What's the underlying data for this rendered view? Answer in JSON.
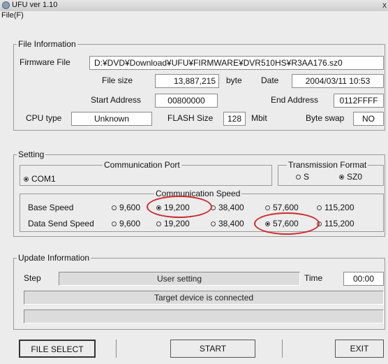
{
  "window": {
    "title": "UFU  ver 1.10",
    "close": "x"
  },
  "menu": {
    "file": "File(F)"
  },
  "file_info": {
    "legend": "File Information",
    "firmware_label": "Firmware File",
    "firmware_path": "D:¥DVD¥Download¥UFU¥FIRMWARE¥DVR510HS¥R3AA176.sz0",
    "filesize_label": "File size",
    "filesize_value": "13,887,215",
    "filesize_unit": "byte",
    "date_label": "Date",
    "date_value": "2004/03/11 10:53",
    "start_label": "Start Address",
    "start_value": "00800000",
    "end_label": "End Address",
    "end_value": "0112FFFF",
    "cpu_label": "CPU type",
    "cpu_value": "Unknown",
    "flash_label": "FLASH Size",
    "flash_value": "128",
    "flash_unit": "Mbit",
    "swap_label": "Byte swap",
    "swap_value": "NO"
  },
  "setting": {
    "legend": "Setting",
    "comm_port_label": "Communication Port",
    "comm_port_option": "COM1",
    "transmission_label": "Transmission Format",
    "transmission_options": [
      "S",
      "SZ0"
    ],
    "transmission_selected": "SZ0",
    "speed_label": "Communication Speed",
    "base_label": "Base Speed",
    "data_label": "Data Send Speed",
    "speeds": [
      "9,600",
      "19,200",
      "38,400",
      "57,600",
      "115,200"
    ],
    "base_selected": "19,200",
    "data_selected": "57,600",
    "highlight_color": "#cc2b2b"
  },
  "update": {
    "legend": "Update Information",
    "step_label": "Step",
    "step_value": "User setting",
    "time_label": "Time",
    "time_value": "00:00",
    "status_text": "Target device is connected",
    "progress": 0
  },
  "buttons": {
    "file_select": "FILE SELECT",
    "start": "START",
    "exit": "EXIT"
  }
}
